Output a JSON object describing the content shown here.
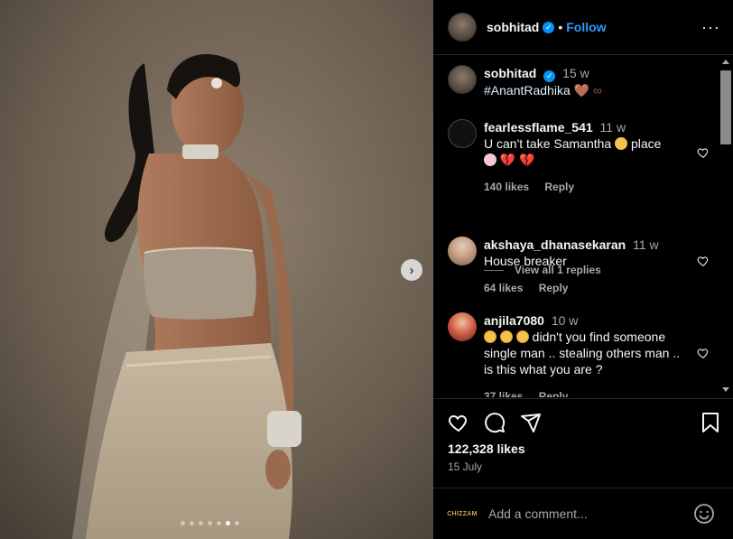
{
  "post": {
    "author": "sobhitad",
    "follow_label": "Follow",
    "more_icon": "more-options-icon",
    "carousel_count": 7,
    "carousel_active": 6
  },
  "caption": {
    "user": "sobhitad",
    "time": "15 w",
    "text": "#AnantRadhika",
    "emoji_trail": "🤎 ∞"
  },
  "comments": [
    {
      "user": "fearlessflame_541",
      "time": "11 w",
      "text_line1": "U can't take Samantha",
      "text_after_emoji": "place",
      "text_line2_emojis": "💔 💔",
      "likes": "140 likes",
      "reply": "Reply",
      "view_replies": "View all 1 replies"
    },
    {
      "user": "akshaya_dhanasekaran",
      "time": "11 w",
      "text": "House breaker",
      "likes": "64 likes",
      "reply": "Reply"
    },
    {
      "user": "anjila7080",
      "time": "10 w",
      "text_line1": "didn't you find someone",
      "text_line2": "single man .. stealing others man ..",
      "text_line3": "is this what you are ?",
      "likes": "37 likes",
      "reply": "Reply"
    }
  ],
  "actions": {
    "likes": "122,328 likes",
    "date": "15 July"
  },
  "composer": {
    "brand": "CHIZZAM",
    "placeholder": "Add a comment..."
  },
  "colors": {
    "accent": "#0095f6",
    "background": "#000000",
    "secondary_text": "#a8a8a8"
  }
}
